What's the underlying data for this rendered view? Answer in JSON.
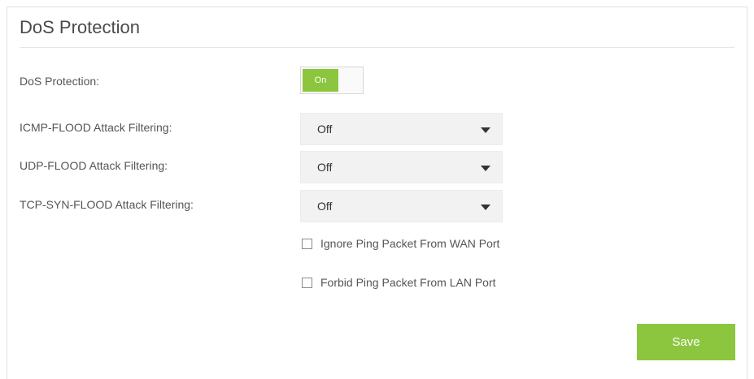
{
  "panel": {
    "title": "DoS Protection"
  },
  "dos_protection": {
    "label": "DoS Protection:",
    "toggle_label": "On"
  },
  "filters": [
    {
      "label": "ICMP-FLOOD Attack Filtering:",
      "value": "Off"
    },
    {
      "label": "UDP-FLOOD Attack Filtering:",
      "value": "Off"
    },
    {
      "label": "TCP-SYN-FLOOD Attack Filtering:",
      "value": "Off"
    }
  ],
  "options": [
    {
      "label": "Ignore Ping Packet From WAN Port",
      "checked": false
    },
    {
      "label": "Forbid Ping Packet From LAN Port",
      "checked": false
    }
  ],
  "actions": {
    "save_label": "Save"
  },
  "colors": {
    "accent": "#8cc63f",
    "select_bg": "#f2f2f2"
  }
}
